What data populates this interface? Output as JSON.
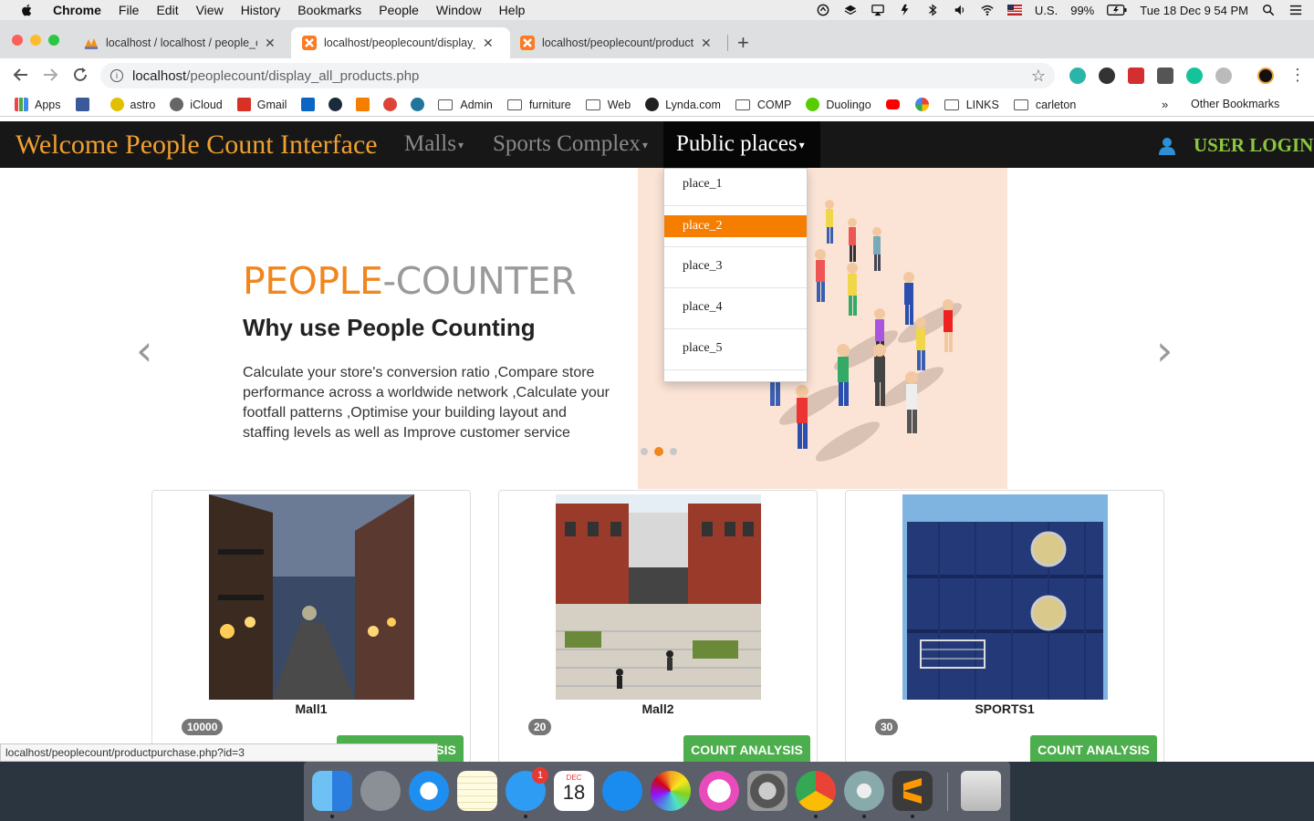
{
  "macos": {
    "app_name": "Chrome",
    "menus": [
      "File",
      "Edit",
      "View",
      "History",
      "Bookmarks",
      "People",
      "Window",
      "Help"
    ],
    "input_source": "U.S.",
    "battery": "99%",
    "datetime": "Tue 18 Dec  9 54 PM"
  },
  "browser": {
    "tabs": [
      {
        "title": "localhost / localhost / people_c",
        "favicon": "phpmyadmin-icon",
        "active": false
      },
      {
        "title": "localhost/peoplecount/display_",
        "favicon": "xampp-icon",
        "active": true
      },
      {
        "title": "localhost/peoplecount/product",
        "favicon": "xampp-icon",
        "active": false
      }
    ],
    "url_host": "localhost",
    "url_path": "/peoplecount/display_all_products.php",
    "bookmarks": [
      "Apps",
      "astro",
      "iCloud",
      "Gmail",
      "Admin",
      "furniture",
      "Web",
      "Lynda.com",
      "COMP",
      "Duolingo",
      "LINKS",
      "carleton"
    ],
    "bookmarks_overflow": "»",
    "other_bookmarks": "Other Bookmarks",
    "status_url": "localhost/peoplecount/productpurchase.php?id=3"
  },
  "site": {
    "brand": "Welcome People Count Interface",
    "nav": [
      {
        "label": "Malls"
      },
      {
        "label": "Sports Complex"
      },
      {
        "label": "Public places"
      }
    ],
    "user_login": "USER LOGIN",
    "dropdown": [
      "place_1",
      "place_2",
      "place_3",
      "place_4",
      "place_5"
    ],
    "dropdown_selected_index": 1
  },
  "carousel": {
    "heading_part1": "PEOPLE",
    "heading_part2": "-COUNTER",
    "subheading": "Why use People Counting",
    "description": "Calculate your store's conversion ratio ,Compare store performance across a worldwide network ,Calculate your footfall patterns ,Optimise your building layout and staffing levels as well as Improve customer service",
    "slide_count": 3,
    "active_slide_index": 1,
    "prev_glyph": "‹",
    "next_glyph": "›"
  },
  "products": [
    {
      "name": "Mall1",
      "count": "10000",
      "button": "COUNT ANALYSIS",
      "image": "street-night-photo"
    },
    {
      "name": "Mall2",
      "count": "20",
      "button": "COUNT ANALYSIS",
      "image": "campus-building-photo"
    },
    {
      "name": "SPORTS1",
      "count": "30",
      "button": "COUNT ANALYSIS",
      "image": "container-building-photo"
    }
  ],
  "dock": {
    "apps": [
      "Finder",
      "Launchpad",
      "Safari",
      "Notes",
      "Messages",
      "Calendar",
      "App Store",
      "Photos",
      "iTunes",
      "System Preferences",
      "Chrome",
      "Server Preferences",
      "Sublime Text",
      "Trash"
    ],
    "messages_badge": "1",
    "calendar_month": "DEC",
    "calendar_day": "18"
  },
  "colors": {
    "brand_orange": "#f0a030",
    "accent_orange": "#f57e00",
    "login_green": "#8cc63f",
    "button_green": "#4cae4c",
    "navbar_bg": "#171717"
  }
}
